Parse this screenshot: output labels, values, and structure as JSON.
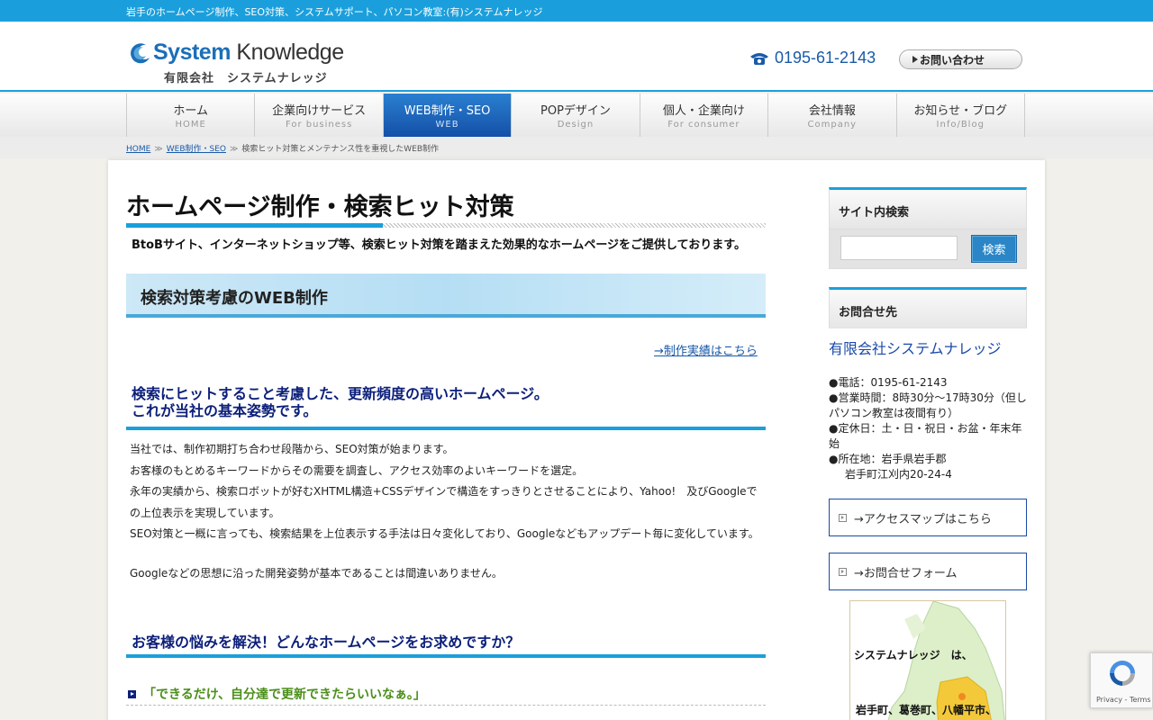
{
  "topbar": {
    "text": "岩手のホームページ制作、SEO対策、システムサポート、パソコン教室:(有)システムナレッジ"
  },
  "header": {
    "logo_en_a": "System",
    "logo_en_b": " Knowledge",
    "logo_jp": "有限会社　システムナレッジ",
    "phone": "0195-61-2143",
    "contact_label": "お問い合わせ"
  },
  "nav": {
    "items": [
      {
        "jp": "ホーム",
        "en": "HOME"
      },
      {
        "jp": "企業向けサービス",
        "en": "For business"
      },
      {
        "jp": "WEB制作・SEO",
        "en": "WEB"
      },
      {
        "jp": "POPデザイン",
        "en": "Design"
      },
      {
        "jp": "個人・企業向け",
        "en": "For consumer"
      },
      {
        "jp": "会社情報",
        "en": "Company"
      },
      {
        "jp": "お知らせ・ブログ",
        "en": "Info/Blog"
      }
    ],
    "active_index": 2
  },
  "breadcrumb": {
    "home": "HOME",
    "section": "WEB制作・SEO",
    "current": "検索ヒット対策とメンテナンス性を重視したWEB制作"
  },
  "main": {
    "title": "ホームページ制作・検索ヒット対策",
    "lead": "BtoBサイト、インターネットショップ等、検索ヒット対策を踏まえた効果的なホームページをご提供しております。",
    "section_title": "検索対策考慮のWEB制作",
    "works_link": "→制作実績はこちら",
    "h3_line1": "検索にヒットすること考慮した、更新頻度の高いホームページ。",
    "h3_line2": "これが当社の基本姿勢です。",
    "paragraphs": [
      "当社では、制作初期打ち合わせ段階から、SEO対策が始まります。",
      "お客様のもとめるキーワードからその需要を調査し、アクセス効率のよいキーワードを選定。",
      "永年の実績から、検索ロボットが好むXHTML構造+CSSデザインで構造をすっきりとさせることにより、Yahoo!　及びGoogleでの上位表示を実現しています。",
      "SEO対策と一概に言っても、検索結果を上位表示する手法は日々変化しており、Googleなどもアップデート毎に変化しています。"
    ],
    "paragraph_last": "Googleなどの思想に沿った開発姿勢が基本であることは間違いありません。",
    "h3b": "お客様の悩みを解決！どんなホームページをお求めですか？",
    "h4": "「できるだけ、自分達で更新できたらいいなぁ。」"
  },
  "sidebar": {
    "search_title": "サイト内検索",
    "search_value": "",
    "search_button": "検索",
    "contact_title": "お問合せ先",
    "company": "有限会社システムナレッジ",
    "info": [
      "●電話：0195-61-2143",
      "●営業時間：8時30分～17時30分（但しパソコン教室は夜間有り）",
      "●定休日：土・日・祝日・お盆・年末年始",
      "●所在地：岩手県岩手郡"
    ],
    "info_indent": "岩手町江刈内20-24-4",
    "access_link": "→アクセスマップはこちら",
    "form_link": "→お問合せフォーム",
    "map_text1": "システムナレッジ　は、",
    "map_text2": "岩手町、葛巻町、八幡平市、"
  },
  "recaptcha": {
    "label": "Privacy - Terms"
  },
  "colors": {
    "accent": "#1b9fdc",
    "nav_active": "#1450a8",
    "heading_navy": "#0c1f7a",
    "green": "#4b8e1a"
  }
}
